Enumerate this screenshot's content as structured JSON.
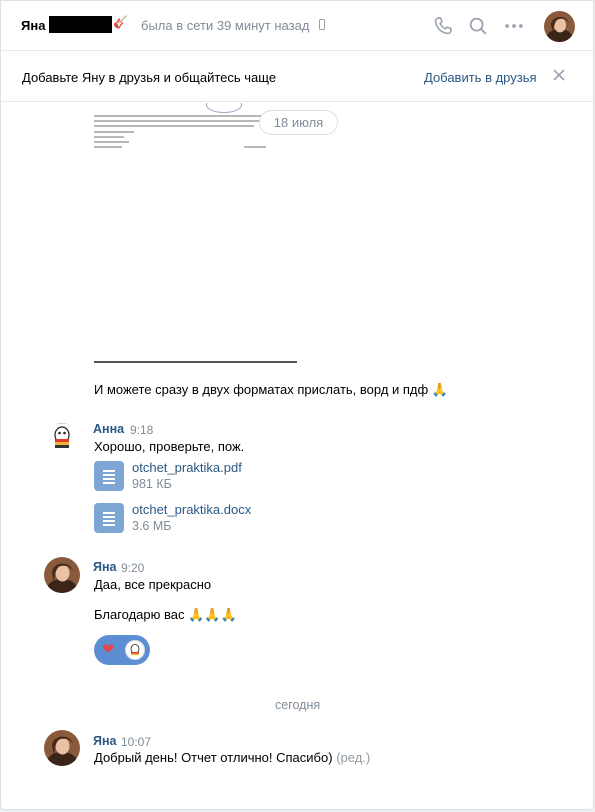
{
  "header": {
    "name": "Яна",
    "status": "была в сети 39 минут назад",
    "icons": [
      "phone-icon",
      "search-icon",
      "more-icon"
    ]
  },
  "banner": {
    "text": "Добавьте Яну в друзья и общайтесь чаще",
    "action": "Добавить в друзья"
  },
  "date_divider": "18 июля",
  "messages": {
    "caption": "И можете сразу в двух форматах прислать, ворд и пдф 🙏",
    "anna": {
      "author": "Анна",
      "time": "9:18",
      "text": "Хорошо, проверьте, пож.",
      "files": [
        {
          "name": "otchet_praktika.pdf",
          "size": "981 КБ"
        },
        {
          "name": "otchet_praktika.docx",
          "size": "3.6 МБ"
        }
      ]
    },
    "yana1": {
      "author": "Яна",
      "time": "9:20",
      "text1": "Даа, все прекрасно",
      "text2": "Благодарю вас 🙏🙏🙏"
    },
    "today": "сегодня",
    "yana2": {
      "author": "Яна",
      "time": "10:07",
      "text": "Добрый день! Отчет отлично! Спасибо)",
      "edited": "(ред.)"
    }
  },
  "colors": {
    "link": "#2a5885",
    "muted": "#818c99",
    "file_icon": "#7da6d5",
    "reaction_bg": "#5b8ed3"
  }
}
